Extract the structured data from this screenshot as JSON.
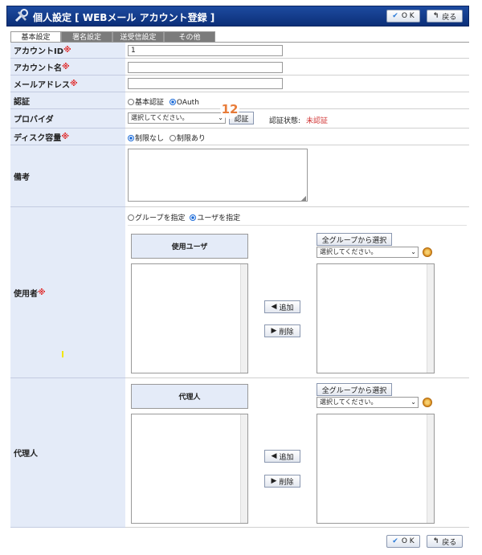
{
  "header": {
    "title": "個人設定 [ WEBメール アカウント登録 ]",
    "ok": "O K",
    "back": "戻る"
  },
  "tabs": [
    "基本設定",
    "署名設定",
    "送受信設定",
    "その他"
  ],
  "fields": {
    "account_id": {
      "label": "アカウントID",
      "req": "※",
      "value": "1"
    },
    "account_name": {
      "label": "アカウント名",
      "req": "※"
    },
    "email": {
      "label": "メールアドレス",
      "req": "※"
    },
    "auth": {
      "label": "認証",
      "opt1": "基本認証",
      "opt2": "OAuth"
    },
    "provider": {
      "label": "プロバイダ",
      "select": "選択してください。",
      "auth_btn": "認証",
      "status_label": "認証状態:",
      "status_value": "未認証",
      "marker": "12"
    },
    "disk": {
      "label": "ディスク容量",
      "req": "※",
      "opt1": "制限なし",
      "opt2": "制限あり"
    },
    "note": {
      "label": "備考"
    },
    "user": {
      "label": "使用者",
      "req": "※",
      "opt1": "グループを指定",
      "opt2": "ユーザを指定",
      "list_header": "使用ユーザ",
      "all_groups": "全グループから選択",
      "select": "選択してください。",
      "add": "追加",
      "remove": "削除"
    },
    "proxy": {
      "label": "代理人",
      "list_header": "代理人",
      "all_groups": "全グループから選択",
      "select": "選択してください。",
      "add": "追加",
      "remove": "削除"
    }
  },
  "footer": {
    "ok": "O K",
    "back": "戻る"
  }
}
